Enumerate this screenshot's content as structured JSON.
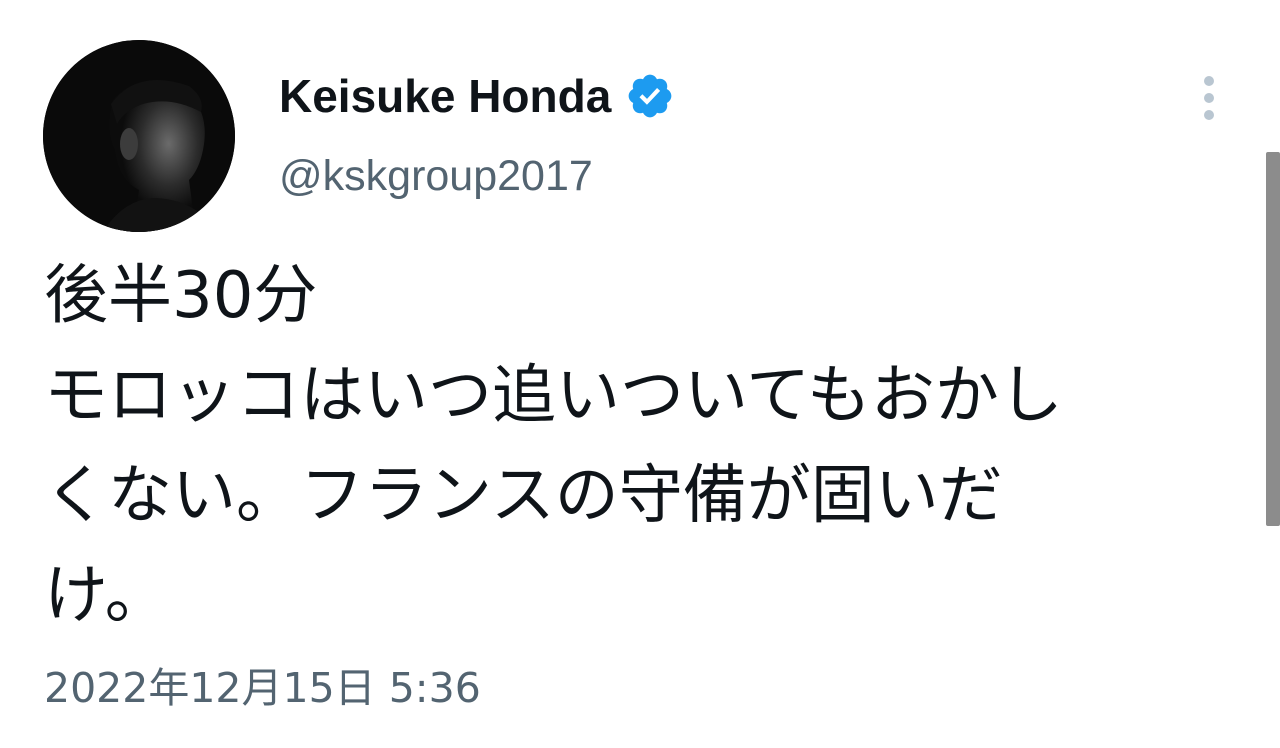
{
  "author": {
    "display_name": "Keisuke Honda",
    "handle": "@kskgroup2017",
    "verified": true,
    "avatar_icon": "profile-photo"
  },
  "tweet": {
    "lines": [
      "後半30分",
      "モロッコはいつ追いついてもおかし",
      "くない。フランスの守備が固いだ",
      "け。"
    ],
    "timestamp": "2022年12月15日 5:36"
  },
  "icons": {
    "verified": "verified-badge-icon",
    "more": "more-options-icon"
  },
  "colors": {
    "text": "#0f1419",
    "secondary": "#536471",
    "verified_blue": "#1d9bf0",
    "more_dots": "#b9c6d1"
  }
}
